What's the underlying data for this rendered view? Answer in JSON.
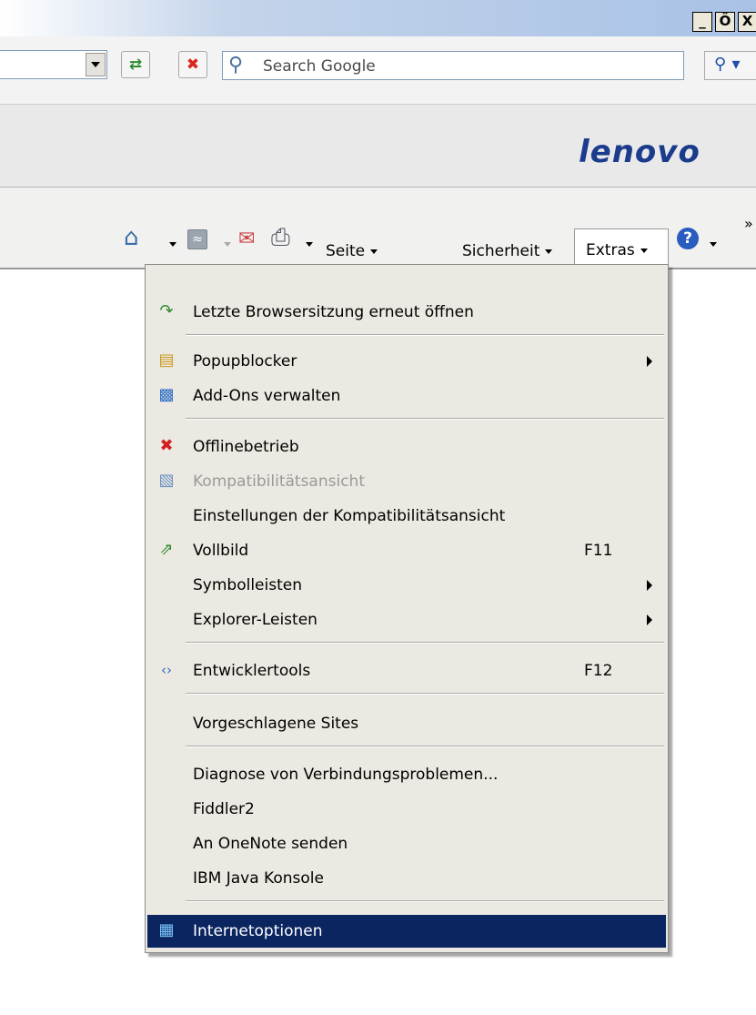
{
  "window": {
    "minimize_label": "_",
    "restore_label": "Ő",
    "close_label": "X"
  },
  "address": {
    "search_placeholder": "Search Google"
  },
  "brand": {
    "logo_text": "lenovo"
  },
  "commandbar": {
    "page_label": "Seite",
    "safety_label": "Sicherheit",
    "tools_label": "Extras",
    "more_label": "»"
  },
  "menu": {
    "items": [
      {
        "label": "Letzte Browsersitzung erneut öffnen",
        "icon": "reopen-session-icon"
      },
      {
        "label": "Popupblocker",
        "icon": "popup-blocker-icon",
        "submenu": true
      },
      {
        "label": "Add-Ons verwalten",
        "icon": "addons-icon"
      },
      {
        "label": "Offlinebetrieb",
        "icon": "offline-icon"
      },
      {
        "label": "Kompatibilitätsansicht",
        "icon": "compatibility-icon",
        "disabled": true
      },
      {
        "label": "Einstellungen der Kompatibilitätsansicht"
      },
      {
        "label": "Vollbild",
        "icon": "fullscreen-icon",
        "shortcut": "F11"
      },
      {
        "label": "Symbolleisten",
        "submenu": true
      },
      {
        "label": "Explorer-Leisten",
        "submenu": true
      },
      {
        "label": "Entwicklertools",
        "icon": "developer-tools-icon",
        "shortcut": "F12"
      },
      {
        "label": "Vorgeschlagene Sites"
      },
      {
        "label": "Diagnose von Verbindungsproblemen..."
      },
      {
        "label": "Fiddler2"
      },
      {
        "label": "An OneNote senden"
      },
      {
        "label": "IBM Java Konsole"
      },
      {
        "label": "Internetoptionen",
        "icon": "internet-options-icon",
        "highlighted": true
      }
    ]
  },
  "colors": {
    "highlight": "#0b2560",
    "menu_bg": "#ece9e2",
    "logo": "#1b3b8c"
  }
}
